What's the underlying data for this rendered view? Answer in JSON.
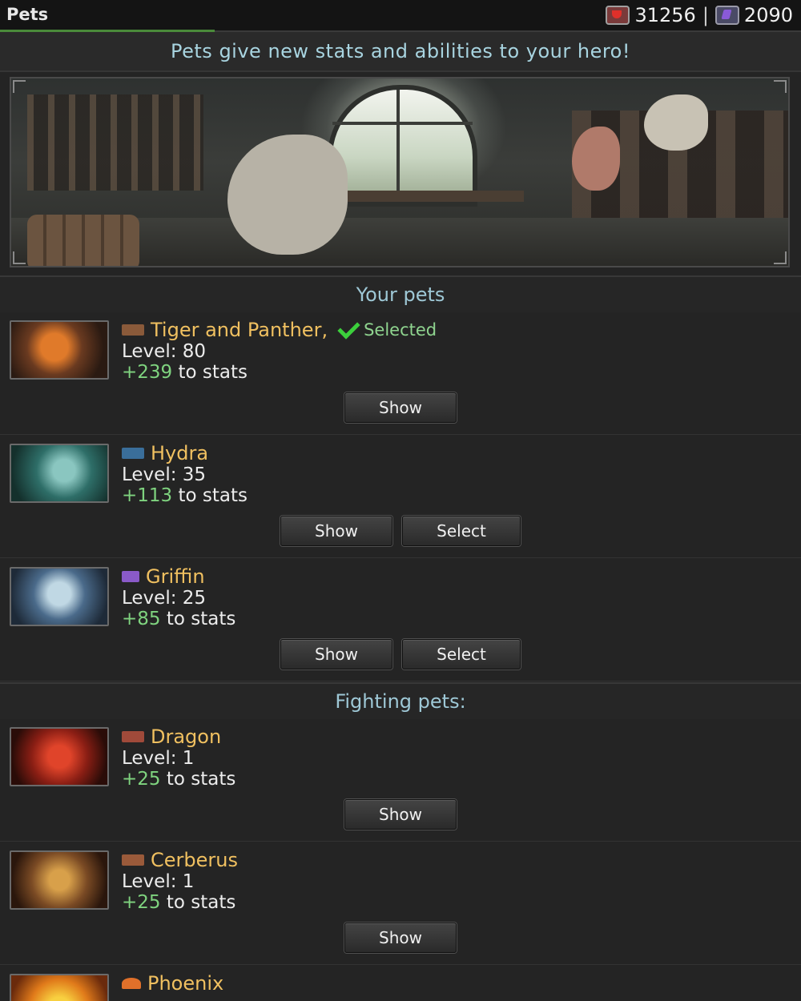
{
  "header": {
    "title": "Pets",
    "currency": {
      "red_value": "31256",
      "separator": "|",
      "purple_value": "2090"
    }
  },
  "subtitle": "Pets give new stats and abilities to your hero!",
  "sections": {
    "your_pets": "Your pets",
    "fighting_pets": "Fighting pets:"
  },
  "pets": [
    {
      "name": "Tiger and Panther",
      "comma": ",",
      "selected_label": "Selected",
      "level": "Level: 80",
      "bonus": "+239",
      "stats_suffix": " to stats",
      "show": "Show"
    },
    {
      "name": "Hydra",
      "level": "Level: 35",
      "bonus": "+113",
      "stats_suffix": " to stats",
      "show": "Show",
      "select": "Select"
    },
    {
      "name": "Griffin",
      "level": "Level: 25",
      "bonus": "+85",
      "stats_suffix": " to stats",
      "show": "Show",
      "select": "Select"
    },
    {
      "name": "Dragon",
      "level": "Level: 1",
      "bonus": "+25",
      "stats_suffix": " to stats",
      "show": "Show"
    },
    {
      "name": "Cerberus",
      "level": "Level: 1",
      "bonus": "+25",
      "stats_suffix": " to stats",
      "show": "Show"
    },
    {
      "name": "Phoenix"
    }
  ],
  "colors": {
    "background": "#242424",
    "pet_name": "#f0c060",
    "stat_bonus": "#7fd37f",
    "section_header": "#9ec8d6",
    "selected_check": "#3ccf3c"
  }
}
